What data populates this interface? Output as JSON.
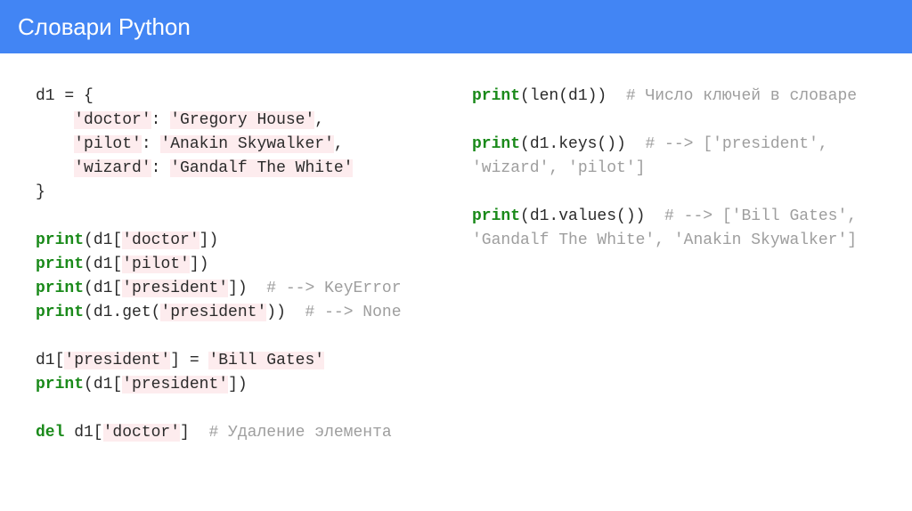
{
  "title": "Словари Python",
  "left": {
    "l1": "d1 = {",
    "l2_pre": "    ",
    "l2_str": "'doctor'",
    "l2_mid": ": ",
    "l2_str2": "'Gregory House'",
    "l2_end": ",",
    "l3_pre": "    ",
    "l3_str": "'pilot'",
    "l3_mid": ": ",
    "l3_str2": "'Anakin Skywalker'",
    "l3_end": ",",
    "l4_pre": "    ",
    "l4_str": "'wizard'",
    "l4_mid": ": ",
    "l4_str2": "'Gandalf The White'",
    "l5": "}",
    "p1_kw": "print",
    "p1_pre": "(d1[",
    "p1_str": "'doctor'",
    "p1_end": "])",
    "p2_pre": "(d1[",
    "p2_str": "'pilot'",
    "p2_end": "])",
    "p3_pre": "(d1[",
    "p3_str": "'president'",
    "p3_end": "])  ",
    "p3_com": "# --> KeyError",
    "p4_pre": "(d1.get(",
    "p4_str": "'president'",
    "p4_end": "))  ",
    "p4_com": "# --> None",
    "a1_pre": "d1[",
    "a1_str": "'president'",
    "a1_mid": "] = ",
    "a1_str2": "'Bill Gates'",
    "p5_pre": "(d1[",
    "p5_str": "'president'",
    "p5_end": "])",
    "del_kw": "del",
    "del_pre": " d1[",
    "del_str": "'doctor'",
    "del_end": "]  ",
    "del_com": "# Удаление элемента"
  },
  "right": {
    "r1_kw": "print",
    "r1_tx": "(len(d1))  ",
    "r1_com": "# Число ключей в словаре",
    "r2_tx": "(d1.keys())  ",
    "r2_com": "# --> ['president', 'wizard', 'pilot']",
    "r3_tx": "(d1.values())  ",
    "r3_com": "# --> ['Bill Gates', 'Gandalf The White', 'Anakin Skywalker']"
  }
}
